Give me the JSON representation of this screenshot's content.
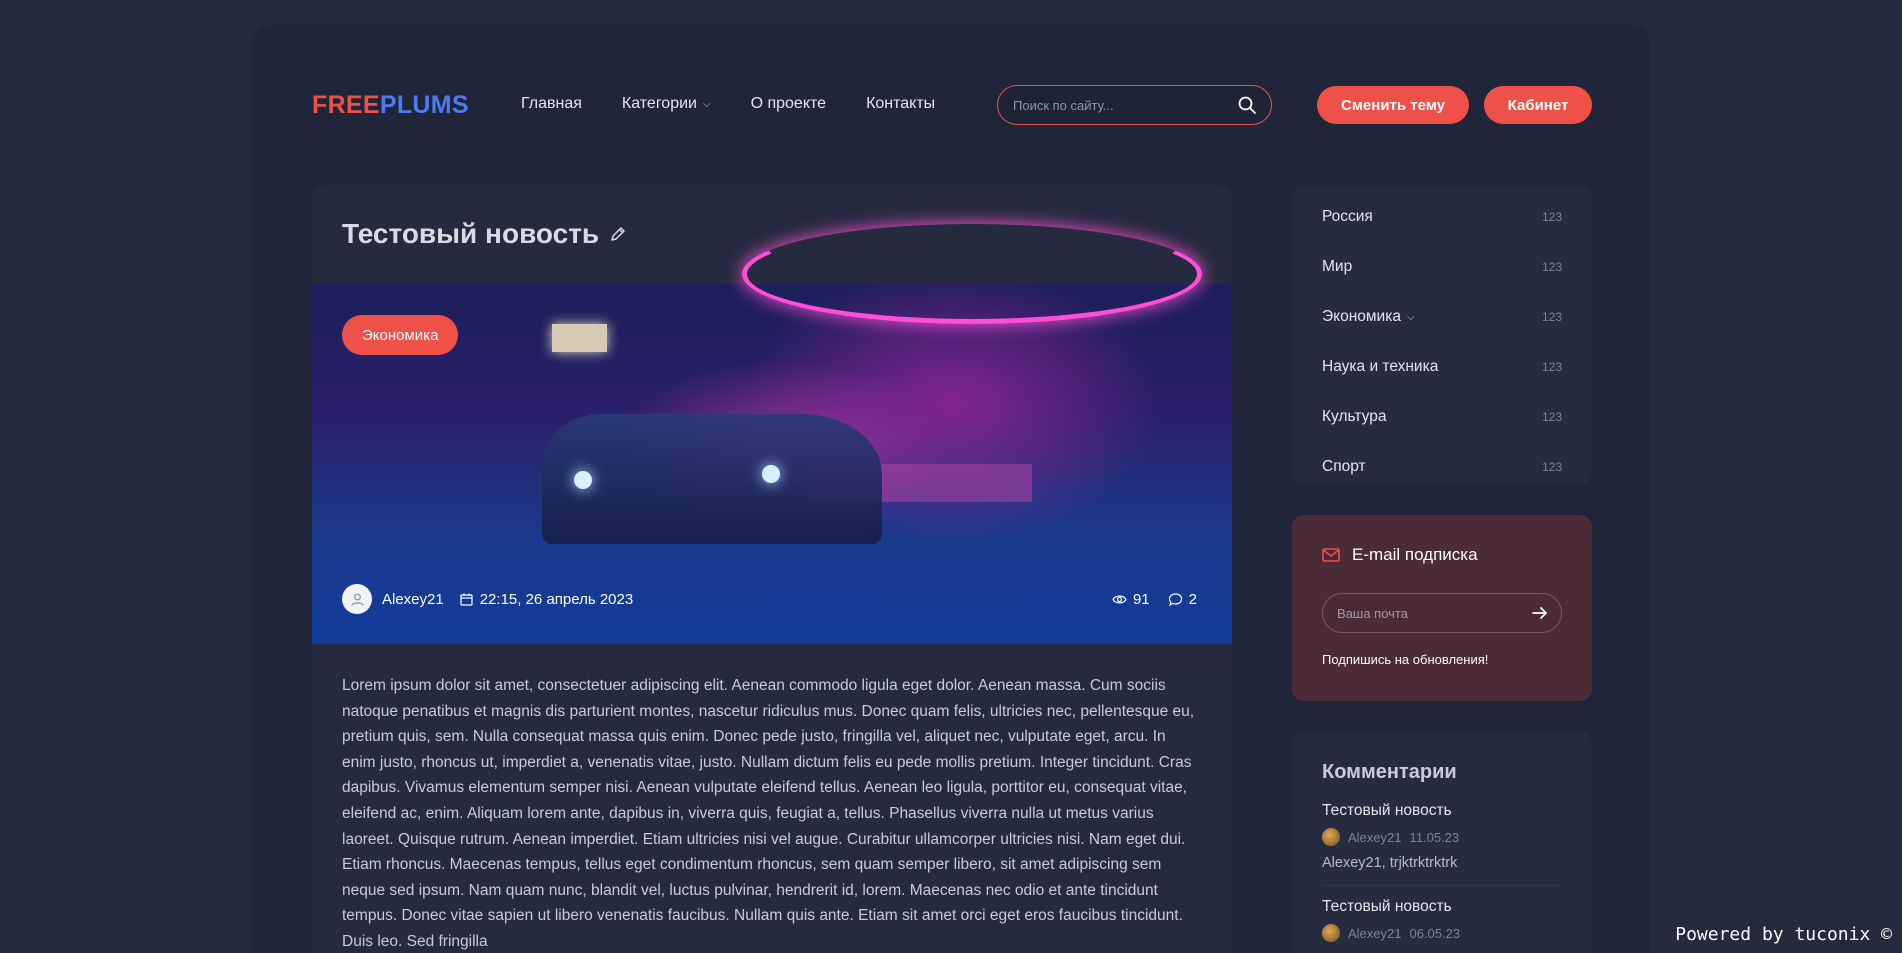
{
  "header": {
    "logo_part1": "FREE",
    "logo_part2": "PLUMS",
    "nav": [
      {
        "label": "Главная"
      },
      {
        "label": "Категории"
      },
      {
        "label": "О проекте"
      },
      {
        "label": "Контакты"
      }
    ],
    "search_placeholder": "Поиск по сайту...",
    "theme_button": "Сменить тему",
    "cabinet_button": "Кабинет"
  },
  "article": {
    "title": "Тестовый новость",
    "category_badge": "Экономика",
    "author": "Alexey21",
    "date": "22:15, 26 апрель 2023",
    "views": "91",
    "comments": "2",
    "body": "Lorem ipsum dolor sit amet, consectetuer adipiscing elit. Aenean commodo ligula eget dolor. Aenean massa. Cum sociis natoque penatibus et magnis dis parturient montes, nascetur ridiculus mus. Donec quam felis, ultricies nec, pellentesque eu, pretium quis, sem. Nulla consequat massa quis enim. Donec pede justo, fringilla vel, aliquet nec, vulputate eget, arcu. In enim justo, rhoncus ut, imperdiet a, venenatis vitae, justo. Nullam dictum felis eu pede mollis pretium. Integer tincidunt. Cras dapibus. Vivamus elementum semper nisi. Aenean vulputate eleifend tellus. Aenean leo ligula, porttitor eu, consequat vitae, eleifend ac, enim. Aliquam lorem ante, dapibus in, viverra quis, feugiat a, tellus. Phasellus viverra nulla ut metus varius laoreet. Quisque rutrum. Aenean imperdiet. Etiam ultricies nisi vel augue. Curabitur ullamcorper ultricies nisi. Nam eget dui. Etiam rhoncus. Maecenas tempus, tellus eget condimentum rhoncus, sem quam semper libero, sit amet adipiscing sem neque sed ipsum. Nam quam nunc, blandit vel, luctus pulvinar, hendrerit id, lorem. Maecenas nec odio et ante tincidunt tempus. Donec vitae sapien ut libero venenatis faucibus. Nullam quis ante. Etiam sit amet orci eget eros faucibus tincidunt. Duis leo. Sed fringilla"
  },
  "categories": [
    {
      "label": "Россия",
      "count": "123"
    },
    {
      "label": "Мир",
      "count": "123"
    },
    {
      "label": "Экономика",
      "count": "123"
    },
    {
      "label": "Наука и техника",
      "count": "123"
    },
    {
      "label": "Культура",
      "count": "123"
    },
    {
      "label": "Спорт",
      "count": "123"
    }
  ],
  "subscribe": {
    "title": "E-mail подписка",
    "placeholder": "Ваша почта",
    "note": "Подпишись на обновления!"
  },
  "comments": {
    "title": "Комментарии",
    "items": [
      {
        "post": "Тестовый новость",
        "author": "Alexey21",
        "date": "11.05.23",
        "text": "Alexey21, trjktrktrktrk"
      },
      {
        "post": "Тестовый новость",
        "author": "Alexey21",
        "date": "06.05.23"
      }
    ]
  },
  "footer": {
    "powered": "Powered by tuconix ©"
  },
  "colors": {
    "accent": "#ef5148",
    "logo_blue": "#4c7bf0",
    "background": "#262a3d",
    "panel": "#21253a"
  }
}
